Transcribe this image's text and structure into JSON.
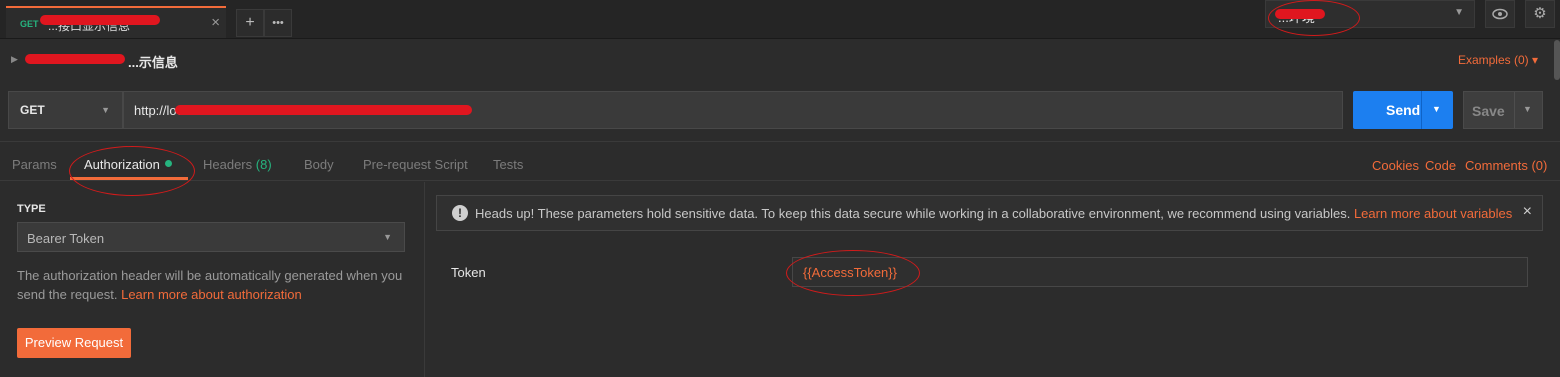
{
  "tab_strip": {
    "request_tab": {
      "method": "GET",
      "title": "...接口显示信息",
      "close": "×"
    },
    "new_tab": "+",
    "more_tabs": "•••"
  },
  "environment": {
    "selected": "...环境",
    "view_icon": "eye-icon",
    "settings_icon": "gear-icon"
  },
  "request": {
    "name": "...示信息",
    "examples": "Examples (0)",
    "method": "GET",
    "url": "http://localhost:5264...",
    "send_label": "Send",
    "save_label": "Save"
  },
  "tabs": [
    {
      "label": "Params"
    },
    {
      "label": "Authorization"
    },
    {
      "label": "Headers",
      "count": "(8)"
    },
    {
      "label": "Body"
    },
    {
      "label": "Pre-request Script"
    },
    {
      "label": "Tests"
    }
  ],
  "right_links": {
    "cookies": "Cookies",
    "code": "Code",
    "comments": "Comments (0)"
  },
  "auth": {
    "type_label": "TYPE",
    "type_value": "Bearer Token",
    "help_text": "The authorization header will be automatically generated when you send the request.",
    "help_link": "Learn more about authorization",
    "preview_button": "Preview Request",
    "warning_text": "Heads up! These parameters hold sensitive data. To keep this data secure while working in a collaborative environment, we recommend using variables.",
    "warning_link": "Learn more about variables",
    "warning_close": "×",
    "token_label": "Token",
    "token_value": "{{AccessToken}}"
  },
  "colors": {
    "accent": "#f26b3a",
    "send_blue": "#1c7ff0",
    "get_green": "#26b47f",
    "annotation_red": "#d11b1b"
  }
}
